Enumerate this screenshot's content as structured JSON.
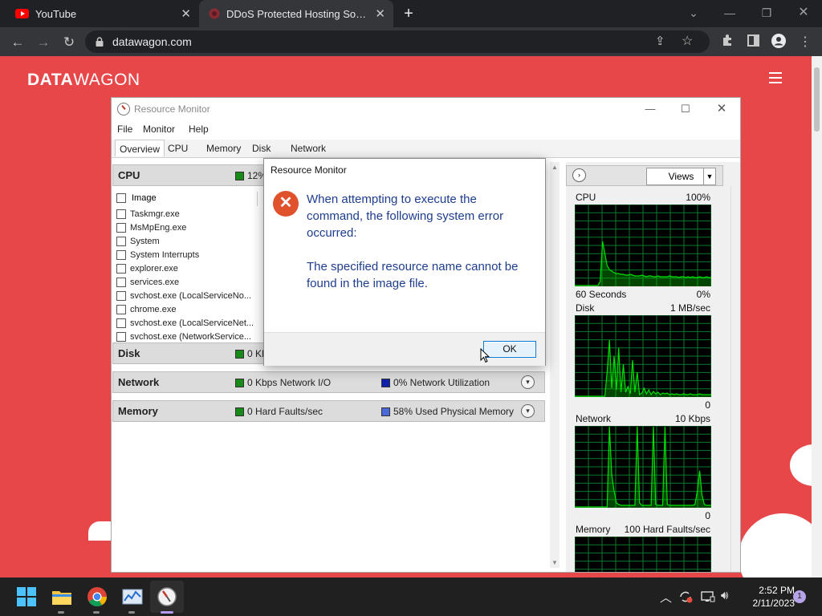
{
  "browser": {
    "tabs": [
      {
        "title": "YouTube",
        "active": false
      },
      {
        "title": "DDoS Protected Hosting Solutions",
        "active": true
      }
    ],
    "new_tab": "+",
    "url": "datawagon.com"
  },
  "site": {
    "logo_bold": "DATA",
    "logo_rest": "WAGON"
  },
  "resource_monitor": {
    "title": "Resource Monitor",
    "menu": [
      "File",
      "Monitor",
      "Help"
    ],
    "tabs": [
      "Overview",
      "CPU",
      "Memory",
      "Disk",
      "Network"
    ],
    "sections": {
      "cpu": {
        "name": "CPU",
        "stat1": "12%"
      },
      "disk": {
        "name": "Disk",
        "stat1": "0 KB"
      },
      "network": {
        "name": "Network",
        "stat1": "0 Kbps Network I/O",
        "stat2": "0% Network Utilization"
      },
      "memory": {
        "name": "Memory",
        "stat1": "0 Hard Faults/sec",
        "stat2": "58% Used Physical Memory"
      }
    },
    "process_header": "Image",
    "processes": [
      "Taskmgr.exe",
      "MsMpEng.exe",
      "System",
      "System Interrupts",
      "explorer.exe",
      "services.exe",
      "svchost.exe (LocalServiceNo...",
      "chrome.exe",
      "svchost.exe (LocalServiceNet...",
      "svchost.exe (NetworkService..."
    ],
    "views_label": "Views",
    "graphs": [
      {
        "name": "CPU",
        "max": "100%",
        "footer_left": "60 Seconds",
        "footer_right": "0%",
        "values": [
          0,
          0,
          0,
          0,
          0,
          0,
          0,
          0,
          0,
          0,
          0,
          5,
          55,
          40,
          25,
          20,
          18,
          16,
          15,
          15,
          14,
          14,
          13,
          13,
          14,
          13,
          12,
          12,
          12,
          13,
          12,
          11,
          12,
          12,
          11,
          11,
          12,
          11,
          11,
          11,
          11,
          12,
          11,
          11,
          11,
          10,
          11,
          11,
          10,
          11,
          10,
          11,
          10,
          10,
          11,
          10,
          10,
          11,
          10,
          10
        ]
      },
      {
        "name": "Disk",
        "max": "1 MB/sec",
        "footer_right": "0",
        "values": [
          0,
          0,
          0,
          0,
          0,
          0,
          0,
          0,
          0,
          0,
          0,
          0,
          0,
          0,
          30,
          70,
          10,
          50,
          8,
          60,
          5,
          40,
          5,
          12,
          3,
          45,
          5,
          30,
          2,
          4,
          10,
          3,
          8,
          2,
          6,
          3,
          5,
          2,
          4,
          3,
          4,
          2,
          3,
          2,
          3,
          2,
          2,
          3,
          2,
          2,
          3,
          2,
          2,
          2,
          3,
          2,
          2,
          2,
          2,
          2
        ]
      },
      {
        "name": "Network",
        "max": "10 Kbps",
        "footer_right": "0",
        "values": [
          0,
          0,
          0,
          0,
          0,
          0,
          0,
          0,
          0,
          0,
          0,
          0,
          0,
          0,
          0,
          100,
          40,
          20,
          5,
          3,
          2,
          2,
          2,
          2,
          2,
          2,
          2,
          100,
          5,
          2,
          2,
          2,
          2,
          2,
          100,
          3,
          2,
          2,
          2,
          100,
          3,
          2,
          2,
          2,
          2,
          2,
          2,
          2,
          2,
          2,
          2,
          2,
          3,
          20,
          45,
          15,
          3,
          2,
          2,
          2
        ]
      },
      {
        "name": "Memory",
        "max": "100 Hard Faults/sec",
        "values": []
      }
    ]
  },
  "dialog": {
    "title": "Resource Monitor",
    "message_line1": "When attempting to execute the command, the following system error occurred:",
    "message_line2": "The specified resource name cannot be found in the image file.",
    "ok_label": "OK"
  },
  "taskbar": {
    "time": "2:52 PM",
    "date": "2/11/2023",
    "notifications": "1"
  },
  "colors": {
    "site_bg": "#e8474a",
    "graph_line": "#00e000",
    "graph_grid": "#0a7a2a",
    "dialog_text": "#1e3d8f",
    "error_icon": "#e0522c"
  }
}
